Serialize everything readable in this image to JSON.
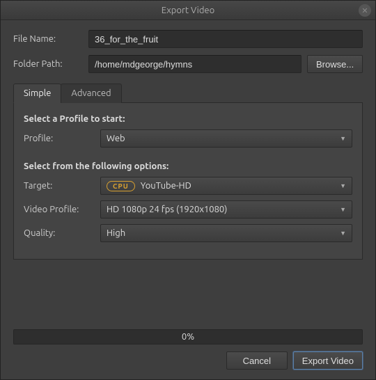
{
  "title": "Export Video",
  "fields": {
    "file_name_label": "File Name:",
    "file_name_value": "36_for_the_fruit",
    "folder_path_label": "Folder Path:",
    "folder_path_value": "/home/mdgeorge/hymns",
    "browse_label": "Browse..."
  },
  "tabs": {
    "simple": "Simple",
    "advanced": "Advanced"
  },
  "sections": {
    "profile_heading": "Select a Profile to start:",
    "profile_label": "Profile:",
    "profile_value": "Web",
    "options_heading": "Select from the following options:",
    "target_label": "Target:",
    "target_badge": "CPU",
    "target_value": "YouTube-HD",
    "video_profile_label": "Video Profile:",
    "video_profile_value": "HD 1080p 24 fps (1920x1080)",
    "quality_label": "Quality:",
    "quality_value": "High"
  },
  "progress_text": "0%",
  "buttons": {
    "cancel": "Cancel",
    "export": "Export Video"
  }
}
